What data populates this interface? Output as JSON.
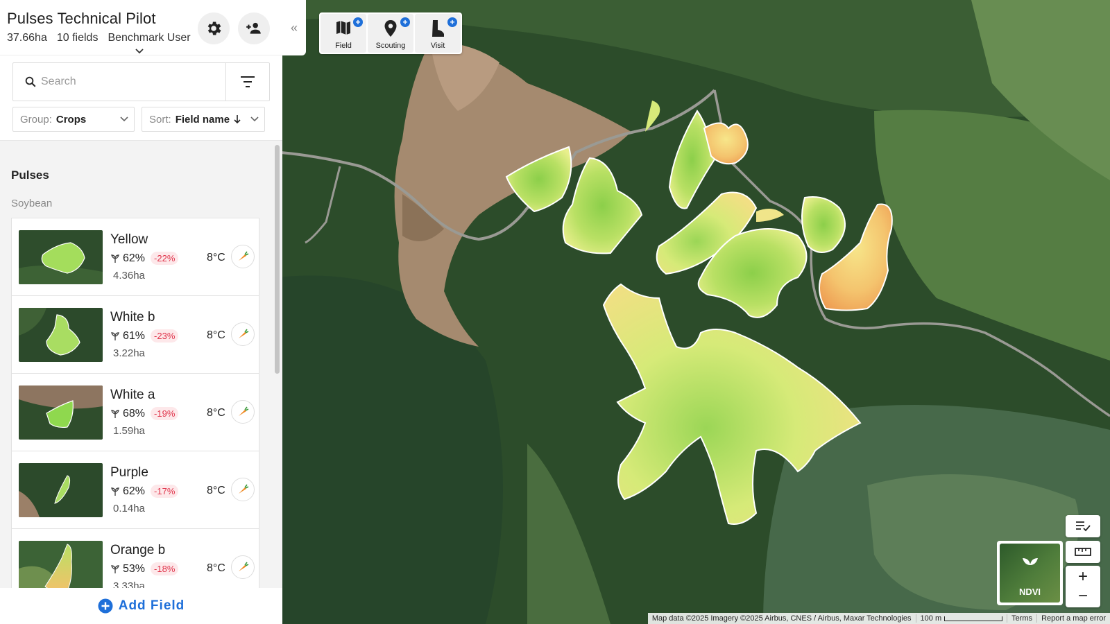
{
  "farm": {
    "title": "Pulses Technical Pilot",
    "area": "37.66ha",
    "fields": "10 fields",
    "user": "Benchmark User"
  },
  "search": {
    "placeholder": "Search"
  },
  "group_select": {
    "label": "Group:",
    "value": "Crops"
  },
  "sort_select": {
    "label": "Sort:",
    "value": "Field name"
  },
  "list": {
    "group_title": "Pulses",
    "subgroup_title": "Soybean",
    "fields": [
      {
        "name": "Yellow",
        "health": "62%",
        "change": "-22%",
        "area": "4.36ha",
        "temp": "8°C"
      },
      {
        "name": "White b",
        "health": "61%",
        "change": "-23%",
        "area": "3.22ha",
        "temp": "8°C"
      },
      {
        "name": "White a",
        "health": "68%",
        "change": "-19%",
        "area": "1.59ha",
        "temp": "8°C"
      },
      {
        "name": "Purple",
        "health": "62%",
        "change": "-17%",
        "area": "0.14ha",
        "temp": "8°C"
      },
      {
        "name": "Orange b",
        "health": "53%",
        "change": "-18%",
        "area": "3.33ha",
        "temp": "8°C"
      }
    ]
  },
  "add_field": "Add Field",
  "collapse_label": "«",
  "toolbar": {
    "field": "Field",
    "scouting": "Scouting",
    "visit": "Visit",
    "plus": "+"
  },
  "map_controls": {
    "ndvi": "NDVI",
    "zoom_in": "+",
    "zoom_out": "−"
  },
  "attribution": {
    "data": "Map data ©2025 Imagery ©2025 Airbus, CNES / Airbus, Maxar Technologies",
    "scale": "100 m",
    "terms": "Terms",
    "report": "Report a map error"
  },
  "colors": {
    "accent": "#1e6fd9",
    "negative": "#e0344b",
    "negative_bg": "#fde8ea"
  }
}
